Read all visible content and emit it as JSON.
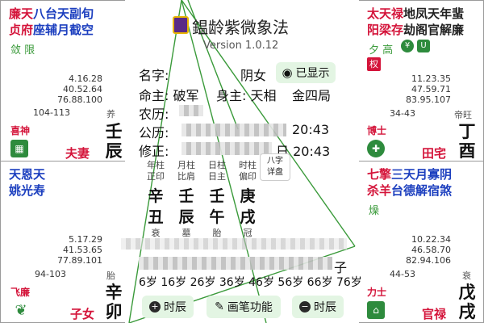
{
  "app": {
    "title": "鎾龄紫微象法",
    "version": "Version 1.0.12"
  },
  "colors": {
    "red": "#d4143a",
    "blue": "#1c3fbf",
    "green": "#2e8b3d"
  },
  "cells": {
    "tl": {
      "stars_red": "廉天",
      "stars_blue": "八台天副旬",
      "stars_red2": "贞府",
      "stars_blue2": "座辅月截空",
      "sub": "敛 限",
      "nums": [
        "4.16.28",
        "40.52.64",
        "76.88.100"
      ],
      "range": "104-113",
      "phase": "养",
      "god": "喜神",
      "palace": "夫妻",
      "stem": "壬",
      "branch": "辰"
    },
    "tr": {
      "stars_red": "太天禄",
      "stars_dark": "地凤天年蜚",
      "stars_red2": "阳梁存",
      "stars_dark2": "劫阁官解廉",
      "sub": "夕 高",
      "badge": "权",
      "nums": [
        "11.23.35",
        "47.59.71",
        "83.95.107"
      ],
      "range": "34-43",
      "phase": "帝旺",
      "god": "博士",
      "palace": "田宅",
      "stem": "丁",
      "branch": "酉"
    },
    "ml": {
      "stars_blue": "天恩天",
      "stars_blue2": "姚光寿",
      "nums": [
        "5.17.29",
        "41.53.65",
        "77.89.101"
      ],
      "range": "94-103",
      "phase": "胎",
      "god": "飞廉",
      "palace": "子女",
      "stem": "辛",
      "branch": "卯"
    },
    "mr": {
      "stars_red": "七擎",
      "stars_blue": "三天月寡阴",
      "stars_red2": "杀羊",
      "stars_blue2": "台德解宿煞",
      "sub": "燥",
      "nums": [
        "10.22.34",
        "46.58.70",
        "82.94.106"
      ],
      "range": "44-53",
      "phase": "衰",
      "god": "力士",
      "palace": "官禄",
      "stem": "戊",
      "branch": "戌"
    }
  },
  "center": {
    "name_label": "名字:",
    "gender": "阴女",
    "show_btn": "已显示",
    "ming_zhu": "命主: 破军",
    "shen_zhu": "身主: 天相",
    "ju": "金四局",
    "nongli": "农历:",
    "gongli": "公历:",
    "xiuzheng": "修正:",
    "gongli_time": "20:43",
    "xiuzheng_time": "日 20:43",
    "pillar_labels": [
      "年柱",
      "月柱",
      "日柱",
      "时柱"
    ],
    "pillar_gods": [
      "正印",
      "比肩",
      "日主",
      "偏印"
    ],
    "gan": [
      "辛",
      "壬",
      "壬",
      "庚"
    ],
    "zhi": [
      "丑",
      "辰",
      "午",
      "戌"
    ],
    "stage": [
      "衰",
      "墓",
      "胎",
      "冠"
    ],
    "bazi_btn_1": "八字",
    "bazi_btn_2": "详盘",
    "ages": "6岁 16岁 26岁 36岁 46岁 56岁 66岁 76岁",
    "row_end": "子",
    "btn_prev": "时辰",
    "btn_draw": "画笔功能",
    "btn_next": "时辰"
  }
}
